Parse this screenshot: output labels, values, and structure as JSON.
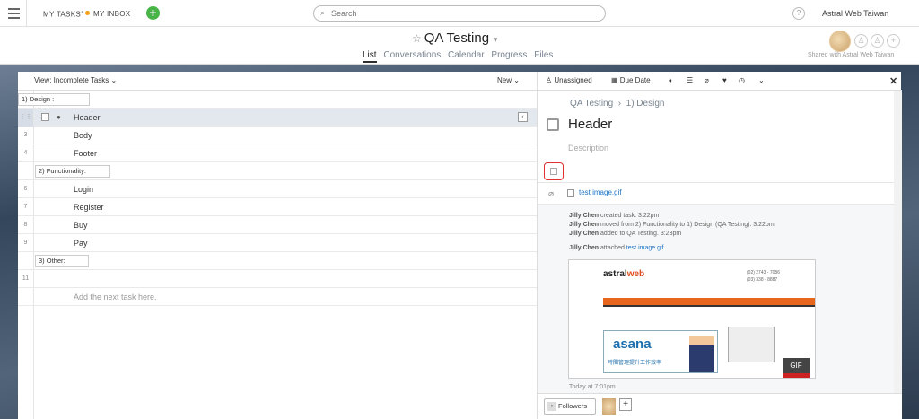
{
  "topbar": {
    "my_tasks": "MY TASKS",
    "my_inbox": "MY INBOX",
    "search_placeholder": "Search",
    "help": "?",
    "user": "Astral Web Taiwan"
  },
  "project": {
    "title": "QA Testing",
    "tabs": [
      {
        "label": "List",
        "active": true
      },
      {
        "label": "Conversations"
      },
      {
        "label": "Calendar"
      },
      {
        "label": "Progress"
      },
      {
        "label": "Files"
      }
    ],
    "shared_with": "Shared with Astral Web Taiwan"
  },
  "list": {
    "view_label": "View: Incomplete Tasks",
    "new_label": "New",
    "sections": {
      "design": "1) Design :",
      "functionality": "2) Functionality:",
      "other": "3) Other:"
    },
    "tasks": [
      {
        "num": "",
        "label": "Header"
      },
      {
        "num": "3",
        "label": "Body"
      },
      {
        "num": "4",
        "label": "Footer"
      },
      {
        "num": "6",
        "label": "Login"
      },
      {
        "num": "7",
        "label": "Register"
      },
      {
        "num": "8",
        "label": "Buy"
      },
      {
        "num": "9",
        "label": "Pay"
      }
    ],
    "empty_row_num": "11",
    "add_next": "Add the next task here."
  },
  "detail": {
    "assignee": "Unassigned",
    "due_date": "Due Date",
    "breadcrumb": [
      "QA Testing",
      "1) Design"
    ],
    "title": "Header",
    "description_placeholder": "Description",
    "attachment": "test image.gif",
    "story": {
      "line1_user": "Jilly Chen",
      "line1": "created task.   3:22pm",
      "line2_user": "Jilly Chen",
      "line2": "moved from 2) Functionality to 1) Design  (QA Testing).   3:22pm",
      "line3_user": "Jilly Chen",
      "line3": "added to QA Testing.   3:23pm",
      "line4_user": "Jilly Chen",
      "line4": "attached",
      "line4_link": "test image.gif",
      "today": "Today at 7:01pm"
    },
    "preview": {
      "logo_a": "astral",
      "logo_b": "web",
      "phone": "(02) 2743 - 7086",
      "phone2": "(03) 338 - 8887",
      "asana": "asana",
      "asana_sub": "時間管理提升工作效率",
      "gif": "GIF"
    },
    "followers_label": "Followers",
    "add": "+"
  },
  "colors": {
    "accent_green": "#48b346",
    "inbox_dot": "#f59c1a",
    "link": "#1a73c8",
    "highlight_border": "#e03030"
  }
}
